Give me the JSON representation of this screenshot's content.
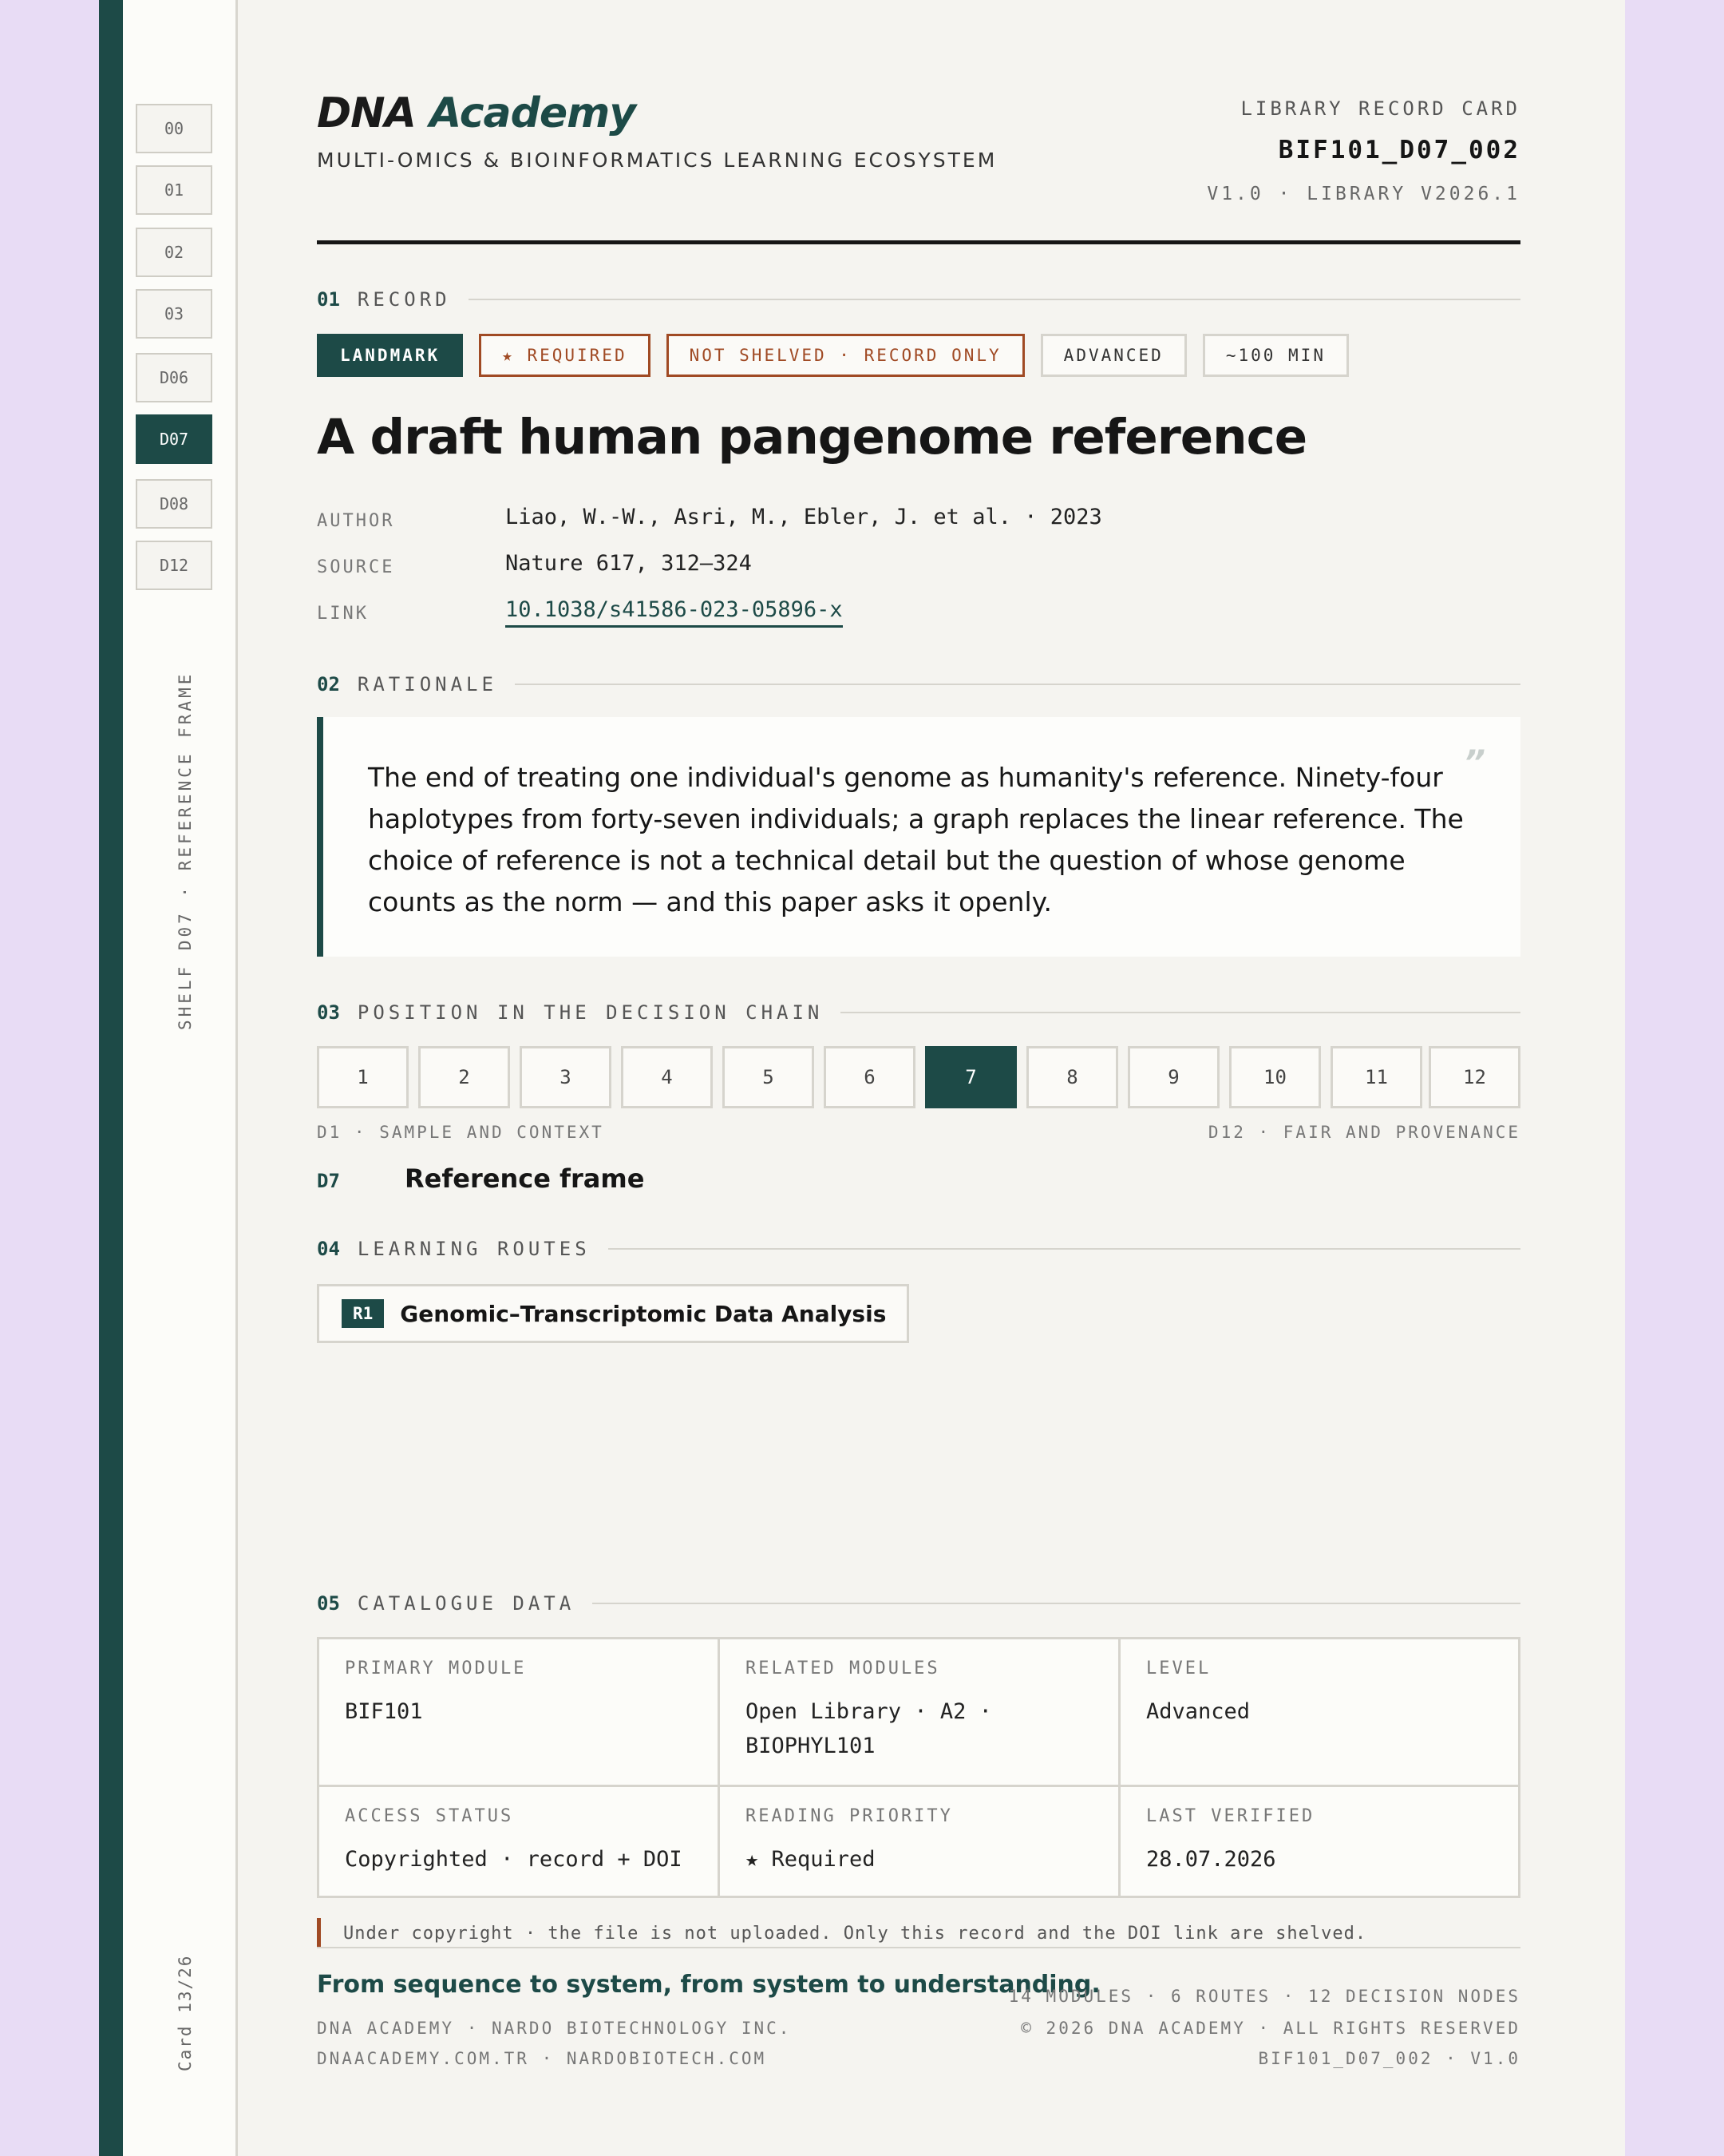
{
  "rail": {
    "items": [
      "00",
      "01",
      "02",
      "03",
      "D06",
      "D07",
      "D08",
      "D12"
    ],
    "active": "D07",
    "vertical_label": "SHELF D07 · REFERENCE FRAME",
    "card_counter": "Card 13/26"
  },
  "header": {
    "brand_dna": "DNA",
    "brand_academy": "Academy",
    "tagline": "MULTI-OMICS & BIOINFORMATICS LEARNING ECOSYSTEM",
    "record_label": "LIBRARY RECORD CARD",
    "record_code": "BIF101_D07_002",
    "record_version": "V1.0 · LIBRARY V2026.1"
  },
  "sections": {
    "s1": {
      "num": "01",
      "title": "RECORD"
    },
    "s2": {
      "num": "02",
      "title": "RATIONALE"
    },
    "s3": {
      "num": "03",
      "title": "POSITION IN THE DECISION CHAIN"
    },
    "s4": {
      "num": "04",
      "title": "LEARNING ROUTES"
    },
    "s5": {
      "num": "05",
      "title": "CATALOGUE DATA"
    }
  },
  "record": {
    "tags": {
      "landmark": "LANDMARK",
      "required": "★ REQUIRED",
      "shelf": "NOT SHELVED · RECORD ONLY",
      "level": "ADVANCED",
      "duration": "~100 MIN"
    },
    "title": "A draft human pangenome reference",
    "author_key": "AUTHOR",
    "author_val": "Liao, W.-W., Asri, M., Ebler, J. et al. · 2023",
    "source_key": "SOURCE",
    "source_val": "Nature 617, 312–324",
    "link_key": "LINK",
    "link_val": "10.1038/s41586-023-05896-x"
  },
  "rationale": {
    "text": "The end of treating one individual's genome as humanity's reference. Ninety-four haplotypes from forty-seven individuals; a graph replaces the linear reference. The choice of reference is not a technical detail but the question of whose genome counts as the norm — and this paper asks it openly.",
    "quote_mark": "”"
  },
  "chain": {
    "nodes": [
      "1",
      "2",
      "3",
      "4",
      "5",
      "6",
      "7",
      "8",
      "9",
      "10",
      "11",
      "12"
    ],
    "active_index": 6,
    "start_label": "D1 · SAMPLE AND CONTEXT",
    "end_label": "D12 · FAIR AND PROVENANCE",
    "current_code": "D7",
    "current_label": "Reference frame"
  },
  "routes": [
    {
      "badge": "R1",
      "label": "Genomic–Transcriptomic Data Analysis"
    }
  ],
  "catalogue": {
    "primary_module_key": "PRIMARY MODULE",
    "primary_module_val": "BIF101",
    "related_modules_key": "RELATED MODULES",
    "related_modules_val_1": "Open Library · A2 ·",
    "related_modules_val_2": "BIOPHYL101",
    "level_key": "LEVEL",
    "level_val": "Advanced",
    "access_key": "ACCESS STATUS",
    "access_val": "Copyrighted · record + DOI",
    "priority_key": "READING PRIORITY",
    "priority_val": "★ Required",
    "verified_key": "LAST VERIFIED",
    "verified_val": "28.07.2026"
  },
  "notice": "Under copyright · the file is not uploaded. Only this record and the DOI link are shelved.",
  "footer": {
    "motto": "From sequence to system, from system to understanding.",
    "left_1": "DNA ACADEMY · NARDO BIOTECHNOLOGY INC.",
    "left_2": "DNAACADEMY.COM.TR · NARDOBIOTECH.COM",
    "right_1": "14 MODULES · 6 ROUTES · 12 DECISION NODES",
    "right_2": "© 2026 DNA ACADEMY · ALL RIGHTS RESERVED",
    "right_3": "BIF101_D07_002 · V1.0"
  },
  "colors": {
    "accent": "#1d4a47",
    "required": "#a04a24",
    "background": "#e8dcf5",
    "paper": "#f5f4f0"
  }
}
